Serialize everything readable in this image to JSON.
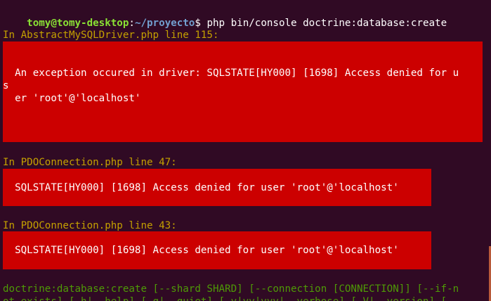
{
  "prompt": {
    "user_host": "tomy@tomy-desktop",
    "colon": ":",
    "path": "~/proyecto",
    "symbol": "$",
    "command": " php bin/console doctrine:database:create"
  },
  "errors": [
    {
      "location": "In AbstractMySQLDriver.php line 115:",
      "message_line1": "  An exception occured in driver: SQLSTATE[HY000] [1698] Access denied for u",
      "wrap_char": "s",
      "message_line2": "  er 'root'@'localhost'"
    },
    {
      "location": "In PDOConnection.php line 47:",
      "message": "  SQLSTATE[HY000] [1698] Access denied for user 'root'@'localhost'"
    },
    {
      "location": "In PDOConnection.php line 43:",
      "message": "  SQLSTATE[HY000] [1698] Access denied for user 'root'@'localhost'"
    }
  ],
  "usage": {
    "line1": "doctrine:database:create [--shard SHARD] [--connection [CONNECTION]] [--if-n",
    "line2": "ot-exists] [-h|--help] [-q|--quiet] [-v|vv|vvv|--verbose] [-V|--version] ["
  },
  "colors": {
    "background": "#300a24",
    "error_block": "#cc0000",
    "location_text": "#c4a000",
    "usage_text": "#4e9a06",
    "prompt_user": "#8ae234",
    "prompt_path": "#729fcf"
  }
}
